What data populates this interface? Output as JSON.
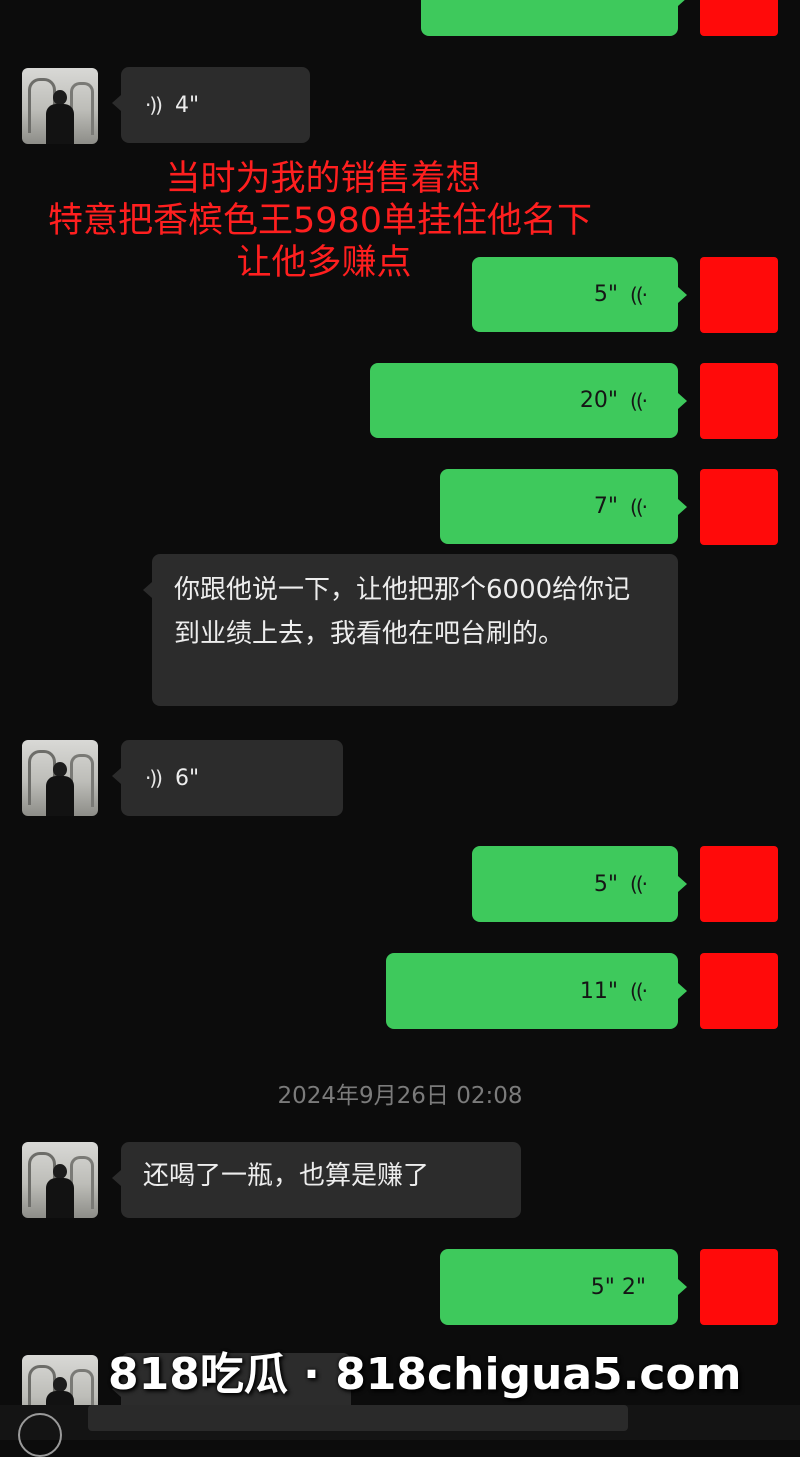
{
  "overlay": {
    "line1": "当时为我的销售着想",
    "line2": "特意把香槟色王5980单挂住他名下",
    "line3": "让他多赚点"
  },
  "messages": {
    "voice_in_1": "4\"",
    "voice_out_1": "5\"",
    "voice_out_2": "20\"",
    "voice_out_3": "7\"",
    "text_in_1": "你跟他说一下，让他把那个6000给你记到业绩上去，我看他在吧台刷的。",
    "voice_in_2": "6\"",
    "voice_out_4": "5\"",
    "voice_out_5": "11\"",
    "timestamp": "2024年9月26日 02:08",
    "text_in_2": "还喝了一瓶，也算是赚了",
    "voice_out_6": "5\" 2\""
  },
  "watermark": "818吃瓜 · 818chigua5.com",
  "colors": {
    "background": "#0c0c0c",
    "incoming_bubble": "#2c2c2c",
    "outgoing_bubble": "#3ec95c",
    "redacted_avatar": "#ff0a0a",
    "overlay_text": "#ff1f1f"
  }
}
